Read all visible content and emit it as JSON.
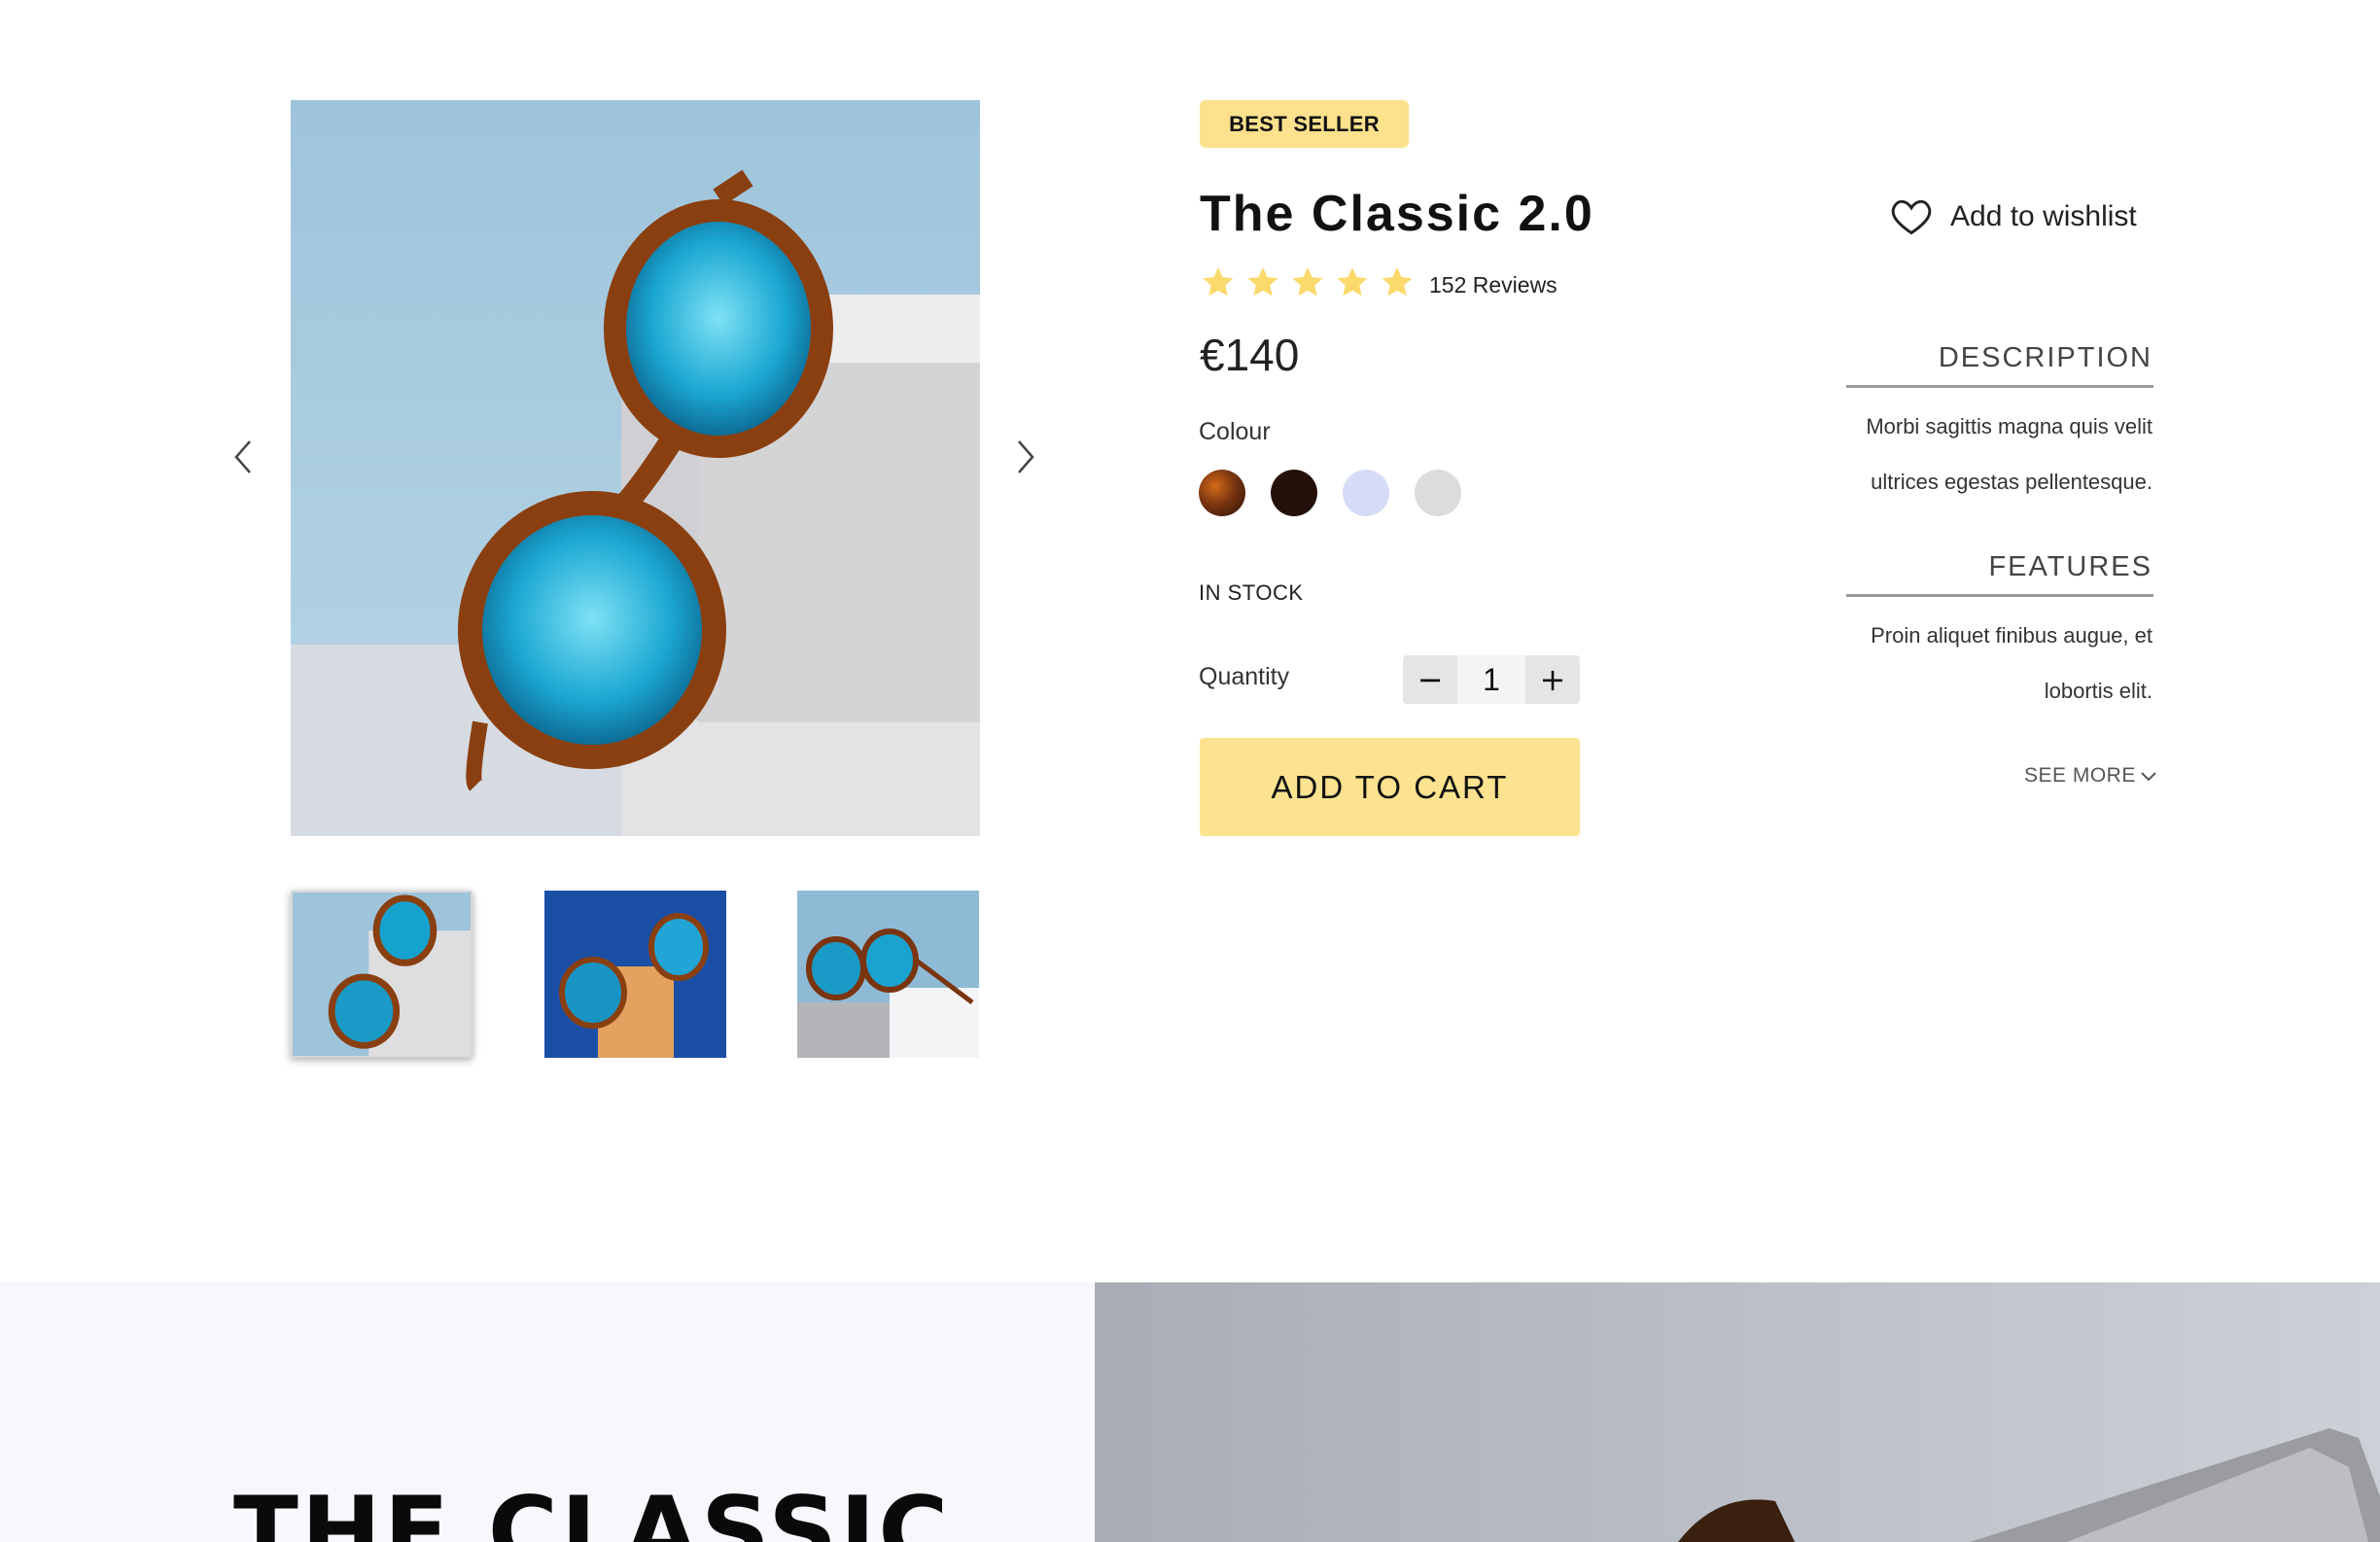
{
  "product": {
    "badge": "BEST SELLER",
    "title": "The Classic 2.0",
    "rating": 5,
    "reviews": "152 Reviews",
    "price": "€140",
    "colour_label": "Colour",
    "colours": [
      {
        "name": "tortoise",
        "color": "#6b3410"
      },
      {
        "name": "dark-brown",
        "color": "#24110a"
      },
      {
        "name": "lavender",
        "color": "#d6dbf7"
      },
      {
        "name": "light-grey",
        "color": "#dcdcdc"
      }
    ],
    "stock_status": "IN STOCK",
    "quantity_label": "Quantity",
    "quantity_value": "1",
    "qty_minus": "−",
    "qty_plus": "+",
    "add_to_cart": "ADD TO CART",
    "wishlist": "Add to wishlist"
  },
  "details": {
    "description_heading": "DESCRIPTION",
    "description_text": "Morbi sagittis magna quis velit ultrices egestas pellentesque.",
    "features_heading": "FEATURES",
    "features_text": "Proin aliquet finibus augue, et lobortis elit.",
    "see_more": "SEE MORE"
  },
  "gallery": {
    "images": [
      "sunglasses-on-white-block",
      "sunglasses-on-orange-block",
      "sunglasses-on-white-ledge"
    ],
    "active_index": 0
  },
  "feature_band": {
    "heading": "THE CLASSIC"
  },
  "colors": {
    "accent": "#fde18c",
    "star": "#fcd96b",
    "band_bg": "#f7f7fc"
  }
}
